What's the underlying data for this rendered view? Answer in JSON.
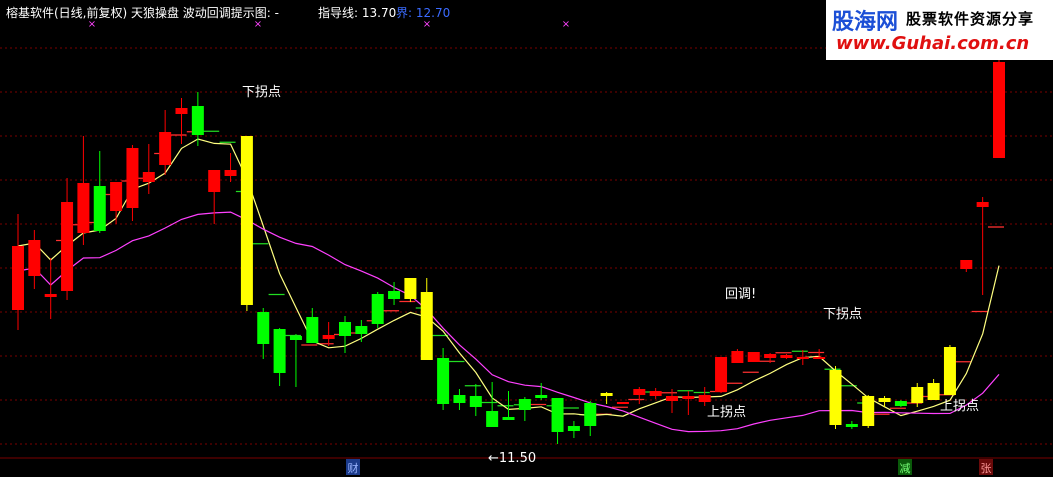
{
  "header": {
    "title": "榕基软件(日线,前复权) 天狼操盘  波动回调提示图: -",
    "guide_label": "指导线: 13.70",
    "bound_label": "界: 12.70"
  },
  "watermark": {
    "brand": "股海网",
    "slogan": "股票软件资源分享",
    "url": "www.Guhai.com.cn"
  },
  "colors": {
    "up": "#ff0000",
    "down": "#00ff00",
    "yellow": "#ffff00",
    "ma_fast": "#ffff80",
    "ma_slow": "#ff40ff",
    "step_red": "#ff3030",
    "step_green": "#22dd22",
    "grid": "#7a0000",
    "text": "#ffffff",
    "blue": "#3b6bff"
  },
  "chart_data": {
    "type": "candlestick",
    "y_range": [
      11.0,
      14.7
    ],
    "candles": [
      {
        "o": 12.2,
        "h": 13.16,
        "l": 12.0,
        "c": 12.84,
        "col": "up"
      },
      {
        "o": 12.54,
        "h": 13.0,
        "l": 12.41,
        "c": 12.9,
        "col": "up"
      },
      {
        "o": 12.33,
        "h": 12.72,
        "l": 12.11,
        "c": 12.36,
        "col": "up"
      },
      {
        "o": 12.39,
        "h": 13.52,
        "l": 12.3,
        "c": 13.28,
        "col": "up"
      },
      {
        "o": 12.97,
        "h": 13.94,
        "l": 12.85,
        "c": 13.47,
        "col": "up"
      },
      {
        "o": 13.44,
        "h": 13.79,
        "l": 12.97,
        "c": 12.99,
        "col": "down"
      },
      {
        "o": 13.19,
        "h": 13.48,
        "l": 13.06,
        "c": 13.48,
        "col": "up"
      },
      {
        "o": 13.22,
        "h": 13.85,
        "l": 13.09,
        "c": 13.82,
        "col": "up"
      },
      {
        "o": 13.48,
        "h": 13.86,
        "l": 13.36,
        "c": 13.58,
        "col": "up"
      },
      {
        "o": 13.65,
        "h": 14.2,
        "l": 13.55,
        "c": 13.98,
        "col": "up"
      },
      {
        "o": 14.16,
        "h": 14.32,
        "l": 13.86,
        "c": 14.22,
        "col": "up"
      },
      {
        "o": 14.24,
        "h": 14.38,
        "l": 13.84,
        "c": 13.95,
        "col": "down"
      },
      {
        "o": 13.38,
        "h": 13.54,
        "l": 13.06,
        "c": 13.6,
        "col": "up"
      },
      {
        "o": 13.6,
        "h": 13.77,
        "l": 13.48,
        "c": 13.54,
        "col": "up"
      },
      {
        "o": 13.94,
        "h": 13.94,
        "l": 12.19,
        "c": 12.25,
        "col": "yellow"
      },
      {
        "o": 12.18,
        "h": 12.22,
        "l": 11.71,
        "c": 11.86,
        "col": "down"
      },
      {
        "o": 12.01,
        "h": 12.02,
        "l": 11.44,
        "c": 11.57,
        "col": "down"
      },
      {
        "o": 11.94,
        "h": 11.96,
        "l": 11.43,
        "c": 11.9,
        "col": "down"
      },
      {
        "o": 12.13,
        "h": 12.22,
        "l": 11.9,
        "c": 11.87,
        "col": "down"
      },
      {
        "o": 11.95,
        "h": 12.08,
        "l": 11.84,
        "c": 11.91,
        "col": "up"
      },
      {
        "o": 12.08,
        "h": 12.14,
        "l": 11.77,
        "c": 11.94,
        "col": "down"
      },
      {
        "o": 12.04,
        "h": 12.1,
        "l": 11.88,
        "c": 11.96,
        "col": "down"
      },
      {
        "o": 12.06,
        "h": 12.38,
        "l": 12.02,
        "c": 12.36,
        "col": "down"
      },
      {
        "o": 12.39,
        "h": 12.48,
        "l": 12.25,
        "c": 12.31,
        "col": "down"
      },
      {
        "o": 12.52,
        "h": 12.51,
        "l": 12.28,
        "c": 12.31,
        "col": "yellow"
      },
      {
        "o": 12.38,
        "h": 12.52,
        "l": 11.72,
        "c": 11.7,
        "col": "yellow"
      },
      {
        "o": 11.72,
        "h": 11.82,
        "l": 11.2,
        "c": 11.26,
        "col": "down"
      },
      {
        "o": 11.35,
        "h": 11.41,
        "l": 11.2,
        "c": 11.27,
        "col": "down"
      },
      {
        "o": 11.23,
        "h": 11.46,
        "l": 11.14,
        "c": 11.34,
        "col": "down"
      },
      {
        "o": 11.19,
        "h": 11.48,
        "l": 11.06,
        "c": 11.03,
        "col": "down"
      },
      {
        "o": 11.1,
        "h": 11.39,
        "l": 11.12,
        "c": 11.13,
        "col": "down"
      },
      {
        "o": 11.2,
        "h": 11.33,
        "l": 11.09,
        "c": 11.31,
        "col": "down"
      },
      {
        "o": 11.32,
        "h": 11.47,
        "l": 11.3,
        "c": 11.35,
        "col": "down"
      },
      {
        "o": 11.32,
        "h": 11.24,
        "l": 10.86,
        "c": 10.98,
        "col": "down"
      },
      {
        "o": 10.99,
        "h": 11.09,
        "l": 10.92,
        "c": 11.04,
        "col": "down"
      },
      {
        "o": 11.27,
        "h": 11.29,
        "l": 10.94,
        "c": 11.04,
        "col": "down"
      },
      {
        "o": 11.34,
        "h": 11.38,
        "l": 11.26,
        "c": 11.37,
        "col": "yellow"
      },
      {
        "o": 11.28,
        "h": 11.27,
        "l": 11.26,
        "c": 11.26,
        "col": "up"
      },
      {
        "o": 11.41,
        "h": 11.43,
        "l": 11.26,
        "c": 11.35,
        "col": "up"
      },
      {
        "o": 11.39,
        "h": 11.42,
        "l": 11.31,
        "c": 11.34,
        "col": "up"
      },
      {
        "o": 11.29,
        "h": 11.41,
        "l": 11.17,
        "c": 11.34,
        "col": "up"
      },
      {
        "o": 11.31,
        "h": 11.39,
        "l": 11.15,
        "c": 11.34,
        "col": "up"
      },
      {
        "o": 11.35,
        "h": 11.43,
        "l": 11.24,
        "c": 11.28,
        "col": "up"
      },
      {
        "o": 11.73,
        "h": 11.73,
        "l": 11.37,
        "c": 11.38,
        "col": "up"
      },
      {
        "o": 11.79,
        "h": 11.81,
        "l": 11.67,
        "c": 11.67,
        "col": "up"
      },
      {
        "o": 11.68,
        "h": 11.78,
        "l": 11.68,
        "c": 11.78,
        "col": "up"
      },
      {
        "o": 11.76,
        "h": 11.77,
        "l": 11.67,
        "c": 11.72,
        "col": "up"
      },
      {
        "o": 11.75,
        "h": 11.76,
        "l": 11.71,
        "c": 11.72,
        "col": "up"
      },
      {
        "o": 11.73,
        "h": 11.8,
        "l": 11.65,
        "c": 11.73,
        "col": "up"
      },
      {
        "o": 11.71,
        "h": 11.81,
        "l": 11.71,
        "c": 11.73,
        "col": "up"
      },
      {
        "o": 11.6,
        "h": 11.64,
        "l": 11.01,
        "c": 11.05,
        "col": "yellow"
      },
      {
        "o": 11.03,
        "h": 11.09,
        "l": 11.01,
        "c": 11.06,
        "col": "down"
      },
      {
        "o": 11.34,
        "h": 11.35,
        "l": 11.02,
        "c": 11.04,
        "col": "yellow"
      },
      {
        "o": 11.32,
        "h": 11.34,
        "l": 11.23,
        "c": 11.28,
        "col": "yellow"
      },
      {
        "o": 11.24,
        "h": 11.3,
        "l": 11.23,
        "c": 11.29,
        "col": "down"
      },
      {
        "o": 11.43,
        "h": 11.47,
        "l": 11.23,
        "c": 11.27,
        "col": "yellow"
      },
      {
        "o": 11.47,
        "h": 11.51,
        "l": 11.33,
        "c": 11.3,
        "col": "yellow"
      },
      {
        "o": 11.83,
        "h": 11.85,
        "l": 11.35,
        "c": 11.35,
        "col": "yellow"
      },
      {
        "o": 12.7,
        "h": 12.67,
        "l": 12.58,
        "c": 12.61,
        "col": "up"
      },
      {
        "o": 13.23,
        "h": 13.33,
        "l": 12.35,
        "c": 13.28,
        "col": "up"
      },
      {
        "o": 13.72,
        "h": 14.7,
        "l": 13.73,
        "c": 14.68,
        "col": "up"
      }
    ],
    "annotations": {
      "top_turn_1": "下拐点",
      "top_turn_2": "下拐点",
      "pullback": "回调!",
      "bottom_turn_1": "上拐点",
      "bottom_turn_2": "上拐点",
      "low_mark": "←11.50"
    },
    "footer_marks": {
      "cai": "财",
      "jian": "减",
      "zhang": "张"
    }
  }
}
